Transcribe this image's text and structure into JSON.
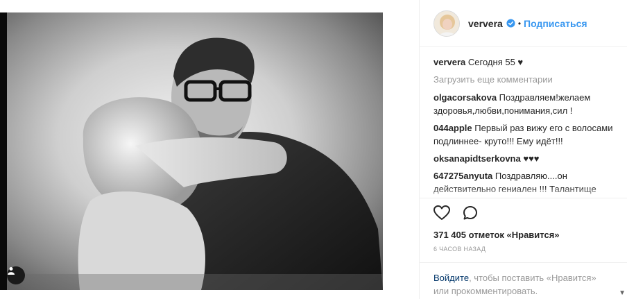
{
  "post": {
    "photo_alt": "",
    "tag_icon": "user-tag-icon"
  },
  "header": {
    "username": "ververa",
    "verified_icon": "verified-badge-icon",
    "separator": "•",
    "follow_label": "Подписаться"
  },
  "caption": {
    "username": "ververa",
    "text": "Сегодня 55 ♥"
  },
  "load_more_label": "Загрузить еще комментарии",
  "comments": [
    {
      "username": "olgacorsakova",
      "text": "Поздравляем!желаем здоровья,любви,понимания,сил !"
    },
    {
      "username": "044apple",
      "text": "Первый раз вижу его с волосами подлиннее- круто!!! Ему идёт!!!"
    },
    {
      "username": "oksanapidtserkovna",
      "text": "♥♥♥"
    },
    {
      "username": "647275anyuta",
      "text": "Поздравляю....он действительно гениален !!! Талантище"
    }
  ],
  "actions": {
    "like_icon": "heart-icon",
    "comment_icon": "comment-icon",
    "likes_text": "371 405 отметок «Нравится»",
    "time_text": "6 часов назад"
  },
  "login": {
    "link_text": "Войдите",
    "rest_text": ", чтобы поставить «Нравится» или прокомментировать."
  },
  "colors": {
    "link": "#3897f0",
    "muted": "#999999",
    "text": "#262626"
  }
}
